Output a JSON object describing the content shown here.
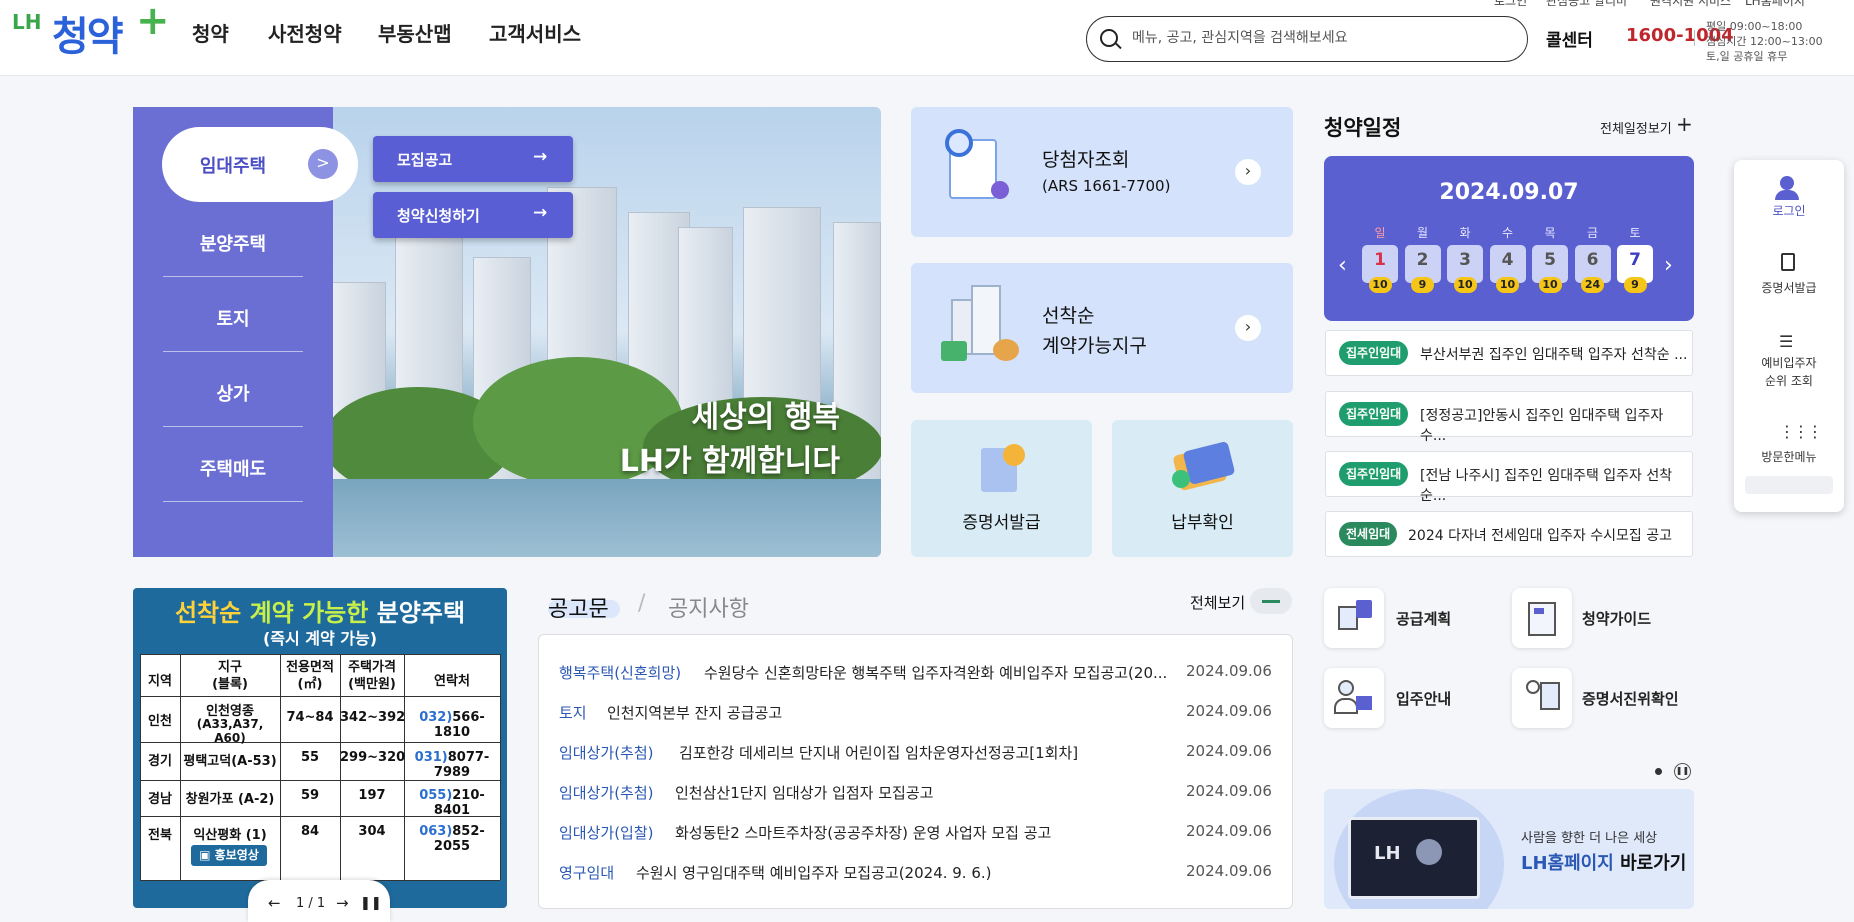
{
  "header": {
    "logo_lh": "LH",
    "logo_main": "청약",
    "logo_plus": "+",
    "nav": [
      "청약",
      "사전청약",
      "부동산맵",
      "고객서비스"
    ],
    "util_links": [
      "로그인",
      "관심공고 알리미",
      "원격지원 서비스",
      "LH홈페이지"
    ],
    "search_placeholder": "메뉴, 공고, 관심지역을 검색해보세요",
    "call_label": "콜센터",
    "call_number": "1600-1004",
    "hours": [
      "평일 09:00~18:00",
      "점심시간 12:00~13:00",
      "토,일 공휴일 휴무"
    ]
  },
  "hero": {
    "tabs": [
      "임대주택",
      "분양주택",
      "토지",
      "상가",
      "주택매도"
    ],
    "buttons": [
      "모집공고",
      "청약신청하기"
    ],
    "slogan_line1": "세상의 행복",
    "slogan_line2": "LH가 함께합니다"
  },
  "services": {
    "winner_title": "당첨자조회",
    "winner_sub": "(ARS 1661-7700)",
    "first_come_line1": "선착순",
    "first_come_line2": "계약가능지구",
    "cert_label": "증명서발급",
    "payment_label": "납부확인"
  },
  "schedule": {
    "title": "청약일정",
    "more": "전체일정보기",
    "date": "2024.09.07",
    "weekdays": [
      "일",
      "월",
      "화",
      "수",
      "목",
      "금",
      "토"
    ],
    "days": [
      "1",
      "2",
      "3",
      "4",
      "5",
      "6",
      "7"
    ],
    "counts": [
      "10",
      "9",
      "10",
      "10",
      "10",
      "24",
      "9"
    ],
    "notices": [
      {
        "tag": "집주인임대",
        "text": "부산서부권 집주인 임대주택 입주자 선착순 ..."
      },
      {
        "tag": "집주인임대",
        "text": "[정정공고]안동시 집주인 임대주택 입주자 수..."
      },
      {
        "tag": "집주인임대",
        "text": "[전남 나주시] 집주인 임대주택 입주자 선착순..."
      },
      {
        "tag": "전세임대",
        "text": "2024 다자녀 전세임대 입주자 수시모집 공고"
      }
    ]
  },
  "quick_menu": {
    "items": [
      "로그인",
      "증명서발급",
      "예비입주자",
      "순위 조회",
      "방문한메뉴"
    ]
  },
  "banner": {
    "title_a": "선착순",
    "title_b": "계약 가능한",
    "title_c": "분양주택",
    "subtitle": "(즉시 계약 가능)",
    "headers": [
      "지역",
      "지구",
      "(블록)",
      "전용면적",
      "(㎡)",
      "주택가격",
      "(백만원)",
      "연락처"
    ],
    "rows": [
      {
        "region": "인천",
        "district": "인천영종",
        "block": "(A33,A37, A60)",
        "area": "74~84",
        "price": "342~392",
        "area_code": "032)",
        "tel": "566-1810"
      },
      {
        "region": "경기",
        "district": "평택고덕(A-53)",
        "block": "",
        "area": "55",
        "price": "299~320",
        "area_code": "031)",
        "tel": "8077-7989"
      },
      {
        "region": "경남",
        "district": "창원가포 (A-2)",
        "block": "",
        "area": "59",
        "price": "197",
        "area_code": "055)",
        "tel": "210-8401"
      },
      {
        "region": "전북",
        "district": "익산평화 (1)",
        "block": "",
        "area": "84",
        "price": "304",
        "area_code": "063)",
        "tel": "852-2055"
      }
    ],
    "video_button": "홍보영상",
    "pager": "1 / 1"
  },
  "notices": {
    "tab_active": "공고문",
    "tab_inactive": "공지사항",
    "more": "전체보기",
    "items": [
      {
        "cat": "행복주택(신혼희망)",
        "title": "수원당수 신혼희망타운 행복주택 입주자격완화 예비입주자 모집공고(20...",
        "date": "2024.09.06"
      },
      {
        "cat": "토지",
        "title": "인천지역본부 잔지 공급공고",
        "date": "2024.09.06"
      },
      {
        "cat": "임대상가(추첨)",
        "title": "김포한강 데세리브 단지내 어린이집 임차운영자선정공고[1회차]",
        "date": "2024.09.06"
      },
      {
        "cat": "임대상가(추첨)",
        "title": "인천삼산1단지 임대상가 입점자 모집공고",
        "date": "2024.09.06"
      },
      {
        "cat": "임대상가(입찰)",
        "title": "화성동탄2 스마트주차장(공공주차장) 운영 사업자 모집 공고",
        "date": "2024.09.06"
      },
      {
        "cat": "영구임대",
        "title": "수원시 영구임대주택 예비입주자 모집공고(2024. 9. 6.)",
        "date": "2024.09.06"
      }
    ]
  },
  "shortcuts": [
    "공급계획",
    "청약가이드",
    "입주안내",
    "증명서진위확인"
  ],
  "lh_banner": {
    "sub": "사람을 향한 더 나은 세상",
    "main_a": "LH홈페이지",
    "main_b": "바로가기",
    "screen_logo": "LH"
  },
  "colors": {
    "primary": "#5b60d1",
    "accent_red": "#c0272d",
    "tag_green": "#1f9d6e",
    "link_blue": "#2b58b5"
  }
}
